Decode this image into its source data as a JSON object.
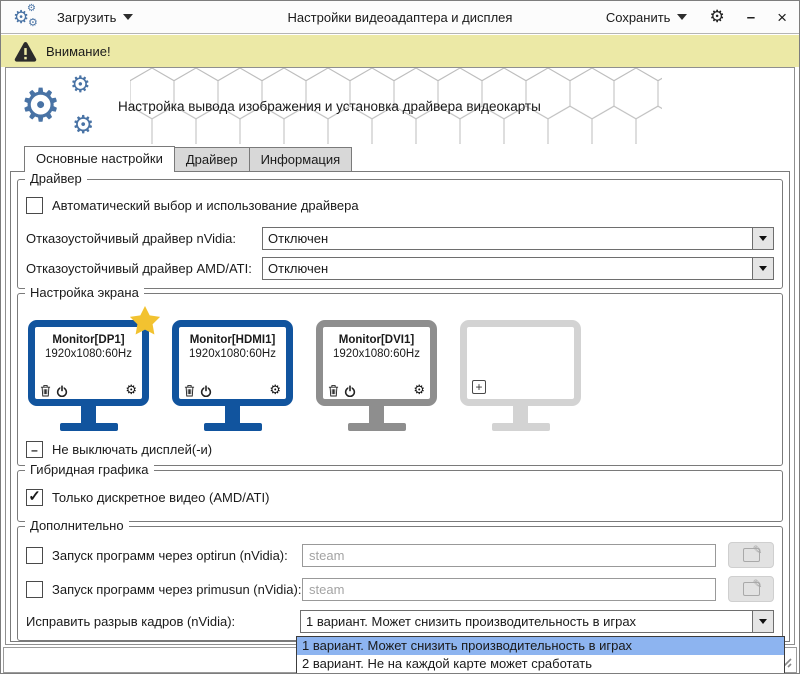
{
  "icons": {
    "gear": "⚙",
    "pencil": "✎",
    "check": "✓",
    "dash": "–",
    "plus": "+",
    "minimize": "–",
    "close": "×"
  },
  "window": {
    "load_label": "Загрузить",
    "title": "Настройки видеоадаптера и дисплея",
    "save_label": "Сохранить"
  },
  "warning": {
    "text": "Внимание!"
  },
  "header": {
    "title": "Настройка вывода изображения и установка драйвера видеокарты"
  },
  "tabs": [
    {
      "label": "Основные настройки",
      "active": true
    },
    {
      "label": "Драйвер",
      "active": false
    },
    {
      "label": "Информация",
      "active": false
    }
  ],
  "driver_group": {
    "title": "Драйвер",
    "auto_label": "Автоматический выбор и использование драйвера",
    "auto_checked": false,
    "nvidia_label": "Отказоустойчивый драйвер nVidia:",
    "nvidia_value": "Отключен",
    "amd_label": "Отказоустойчивый драйвер AMD/ATI:",
    "amd_value": "Отключен"
  },
  "screen_group": {
    "title": "Настройка экрана",
    "monitors": [
      {
        "name": "Monitor[DP1]",
        "mode": "1920x1080:60Hz",
        "starred": true,
        "state": "active-blue"
      },
      {
        "name": "Monitor[HDMI1]",
        "mode": "1920x1080:60Hz",
        "starred": false,
        "state": "active-blue"
      },
      {
        "name": "Monitor[DVI1]",
        "mode": "1920x1080:60Hz",
        "starred": false,
        "state": "inactive-gray"
      },
      {
        "name": "",
        "mode": "",
        "starred": false,
        "state": "empty-add-slot"
      }
    ],
    "keep_on_label": "Не выключать дисплей(-и)",
    "keep_on_state": "indeterminate"
  },
  "hybrid_group": {
    "title": "Гибридная графика",
    "discrete_label": "Только дискретное видео (AMD/ATI)",
    "discrete_checked": true
  },
  "extra_group": {
    "title": "Дополнительно",
    "optirun_label": "Запуск программ через optirun (nVidia):",
    "optirun_checked": false,
    "optirun_placeholder": "steam",
    "primusun_label": "Запуск программ через primusun (nVidia):",
    "primusun_checked": false,
    "primusun_placeholder": "steam",
    "tearing_label": "Исправить разрыв кадров (nVidia):",
    "tearing_value": "1 вариант. Может снизить производительность в играх",
    "dropdown_open": true,
    "selected_option_index": 0,
    "tearing_options": [
      "1 вариант. Может снизить производительность в играх",
      "2 вариант. Не на каждой карте может сработать"
    ]
  },
  "colors": {
    "monitor_blue": "#11549E",
    "monitor_gray": "#8E8E8E",
    "monitor_inactive": "#D3D3D3",
    "star_gold": "#F2C230",
    "warning_bg": "#ECE9A6",
    "selection_blue": "#8DB4F0",
    "icon_blue": "#4973A5",
    "tab_inactive": "#D8D8D8"
  }
}
